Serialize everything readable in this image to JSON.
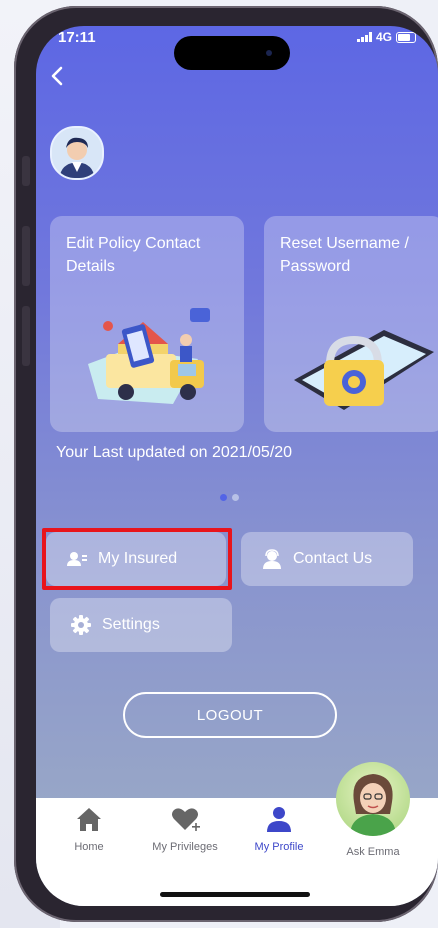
{
  "status": {
    "time": "17:11",
    "network": "4G"
  },
  "nav": {
    "back_icon": "chevron-left-icon"
  },
  "cards": [
    {
      "title": "Edit Policy Contact Details",
      "icon": "delivery-truck-illustration"
    },
    {
      "title": "Reset Username / Password",
      "icon": "padlock-phone-illustration"
    }
  ],
  "last_updated": "Your Last updated on 2021/05/20",
  "carousel": {
    "pages": 2,
    "active": 1
  },
  "actions": {
    "my_insured": "My Insured",
    "contact_us": "Contact Us",
    "settings": "Settings",
    "logout": "LOGOUT"
  },
  "tabs": {
    "home": "Home",
    "privileges": "My Privileges",
    "profile": "My Profile",
    "ask_emma": "Ask Emma"
  },
  "colors": {
    "accent": "#3d47c9",
    "highlight": "#e8141c"
  }
}
